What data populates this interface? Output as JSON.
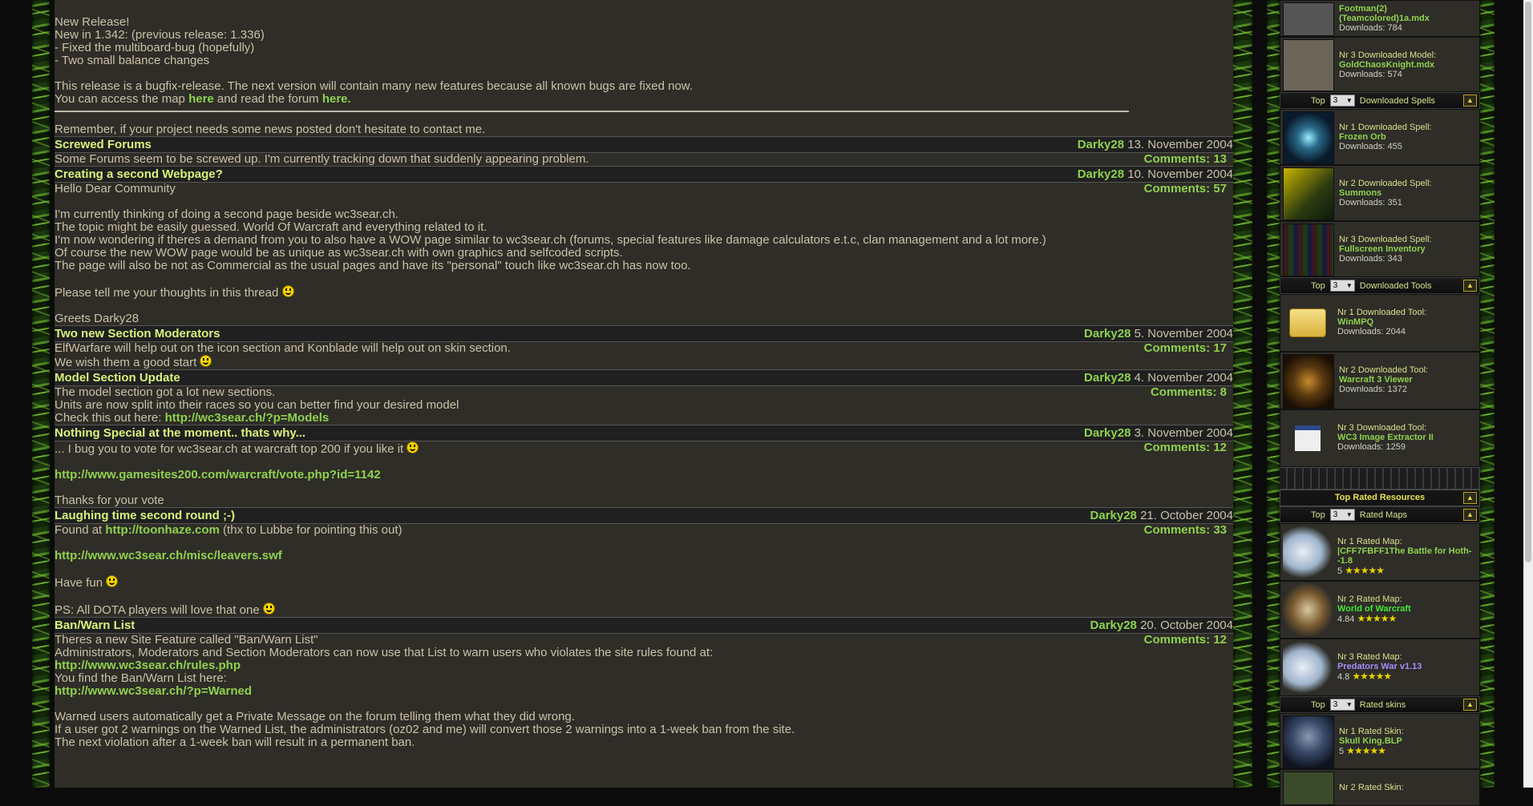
{
  "top_post": {
    "lines": [
      "New Release!",
      "New in 1.342: (previous release: 1.336)",
      "- Fixed the multiboard-bug (hopefully)",
      "- Two small balance changes",
      "",
      "This release is a bugfix-release. The next version will contain many new features because all known bugs are fixed now."
    ],
    "access_prefix": "You can access the map ",
    "access_link1": "here",
    "access_mid": " and read the forum ",
    "access_link2": "here.",
    "remember": "Remember, if your project needs some news posted don't hesitate to contact me."
  },
  "posts": [
    {
      "title": "Screwed Forums",
      "author": "Darky28",
      "date": "13. November 2004",
      "comments": "Comments: 13",
      "lines": [
        "Some Forums seem to be screwed up. I'm currently tracking down that suddenly appearing problem."
      ]
    },
    {
      "title": "Creating a second Webpage?",
      "author": "Darky28",
      "date": "10. November 2004",
      "comments": "Comments: 57",
      "lines": [
        "Hello Dear Community",
        "",
        "I'm currently thinking of doing a second page beside wc3sear.ch.",
        "The topic might be easily guessed. World Of Warcraft and everything related to it.",
        "I'm now wondering if theres a demand from you to also have a WOW page similar to wc3sear.ch (forums, special features like damage calculators e.t.c, clan management and a lot more.)",
        "Of course the new WOW page would be as unique as wc3sear.ch with own graphics and selfcoded scripts.",
        "The page will also be not as Commercial as the usual pages and have its \"personal\" touch like wc3sear.ch has now too.",
        "",
        "Please tell me your thoughts in this thread",
        "",
        "Greets Darky28"
      ]
    },
    {
      "title": "Two new Section Moderators",
      "author": "Darky28",
      "date": "5. November 2004",
      "comments": "Comments: 17",
      "lines": [
        "ElfWarfare will help out on the icon section and Konblade will help out on skin section.",
        "We wish them a good start"
      ]
    },
    {
      "title": "Model Section Update",
      "author": "Darky28",
      "date": "4. November 2004",
      "comments": "Comments: 8",
      "lines": [
        "The model section got a lot new sections.",
        "Units are now split into their races so you can better find your desired model"
      ],
      "check_prefix": "Check this out here: ",
      "check_link": "http://wc3sear.ch/?p=Models"
    },
    {
      "title": "Nothing Special at the moment.. thats why...",
      "author": "Darky28",
      "date": "3. November 2004",
      "comments": "Comments: 12",
      "line1": "... I bug you to vote for wc3sear.ch at warcraft top 200 if you like it",
      "link": "http://www.gamesites200.com/warcraft/vote.php?id=1142",
      "line2": "Thanks for your vote"
    },
    {
      "title": "Laughing time second round ;-)",
      "author": "Darky28",
      "date": "21. October 2004",
      "comments": "Comments: 33",
      "found_prefix": "Found at ",
      "found_link": "http://toonhaze.com",
      "found_suffix": " (thx to Lubbe for pointing this out)",
      "link": "http://www.wc3sear.ch/misc/leavers.swf",
      "have_fun": "Have fun",
      "ps": "PS: All DOTA players will love that one"
    },
    {
      "title": "Ban/Warn List",
      "author": "Darky28",
      "date": "20. October 2004",
      "comments": "Comments: 12",
      "l1": "Theres a new Site Feature called \"Ban/Warn List\"",
      "l2": "Administrators, Moderators and Section Moderators can now use that List to warn users who violates the site rules found at:",
      "link1": "http://www.wc3sear.ch/rules.php",
      "l3": "You find the Ban/Warn List here:",
      "link2": "http://www.wc3sear.ch/?p=Warned",
      "l4": "Warned users automatically get a Private Message on the forum telling them what they did wrong.",
      "l5": "If a user got 2 warnings on the Warned List, the administrators (oz02 and me) will convert those 2 warnings into a 1-week ban from the site.",
      "l6": "The next violation after a 1-week ban will result in a permanent ban."
    }
  ],
  "sidebar": {
    "top_partial": {
      "name": "Footman(2)(Teamcolored)1a.mdx",
      "downloads": "Downloads: 784"
    },
    "model3": {
      "label": "Nr 3 Downloaded Model:",
      "name": "GoldChaosKnight.mdx",
      "downloads": "Downloads: 574"
    },
    "spells_bar": {
      "top": "Top",
      "select": "3",
      "label": "Downloaded Spells"
    },
    "spells": [
      {
        "label": "Nr 1 Downloaded Spell:",
        "name": "Frozen Orb",
        "downloads": "Downloads: 455"
      },
      {
        "label": "Nr 2 Downloaded Spell:",
        "name": "Summons",
        "downloads": "Downloads: 351"
      },
      {
        "label": "Nr 3 Downloaded Spell:",
        "name": "Fullscreen Inventory",
        "downloads": "Downloads: 343"
      }
    ],
    "tools_bar": {
      "top": "Top",
      "select": "3",
      "label": "Downloaded Tools"
    },
    "tools": [
      {
        "label": "Nr 1 Downloaded Tool:",
        "name": "WinMPQ",
        "downloads": "Downloads: 2044"
      },
      {
        "label": "Nr 2 Downloaded Tool:",
        "name": "Warcraft 3 Viewer",
        "downloads": "Downloads: 1372"
      },
      {
        "label": "Nr 3 Downloaded Tool:",
        "name": "WC3 Image Extractor II",
        "downloads": "Downloads: 1259"
      }
    ],
    "rated_title": "Top Rated Resources",
    "maps_bar": {
      "top": "Top",
      "select": "3",
      "label": "Rated Maps"
    },
    "maps": [
      {
        "label": "Nr 1 Rated Map:",
        "name": "|CFF7FBFF1The Battle for Hoth-",
        "name2": "-1.8",
        "rating": "5"
      },
      {
        "label": "Nr 2 Rated Map:",
        "name": "World of Warcraft",
        "rating": "4.84"
      },
      {
        "label": "Nr 3 Rated Map:",
        "name": "Predators War v1.13",
        "rating": "4.8"
      }
    ],
    "skins_bar": {
      "top": "Top",
      "select": "3",
      "label": "Rated skins"
    },
    "skins": [
      {
        "label": "Nr 1 Rated Skin:",
        "name": "Skull King.BLP",
        "rating": "5"
      },
      {
        "label": "Nr 2 Rated Skin:"
      }
    ],
    "stars": "★★★★★"
  }
}
